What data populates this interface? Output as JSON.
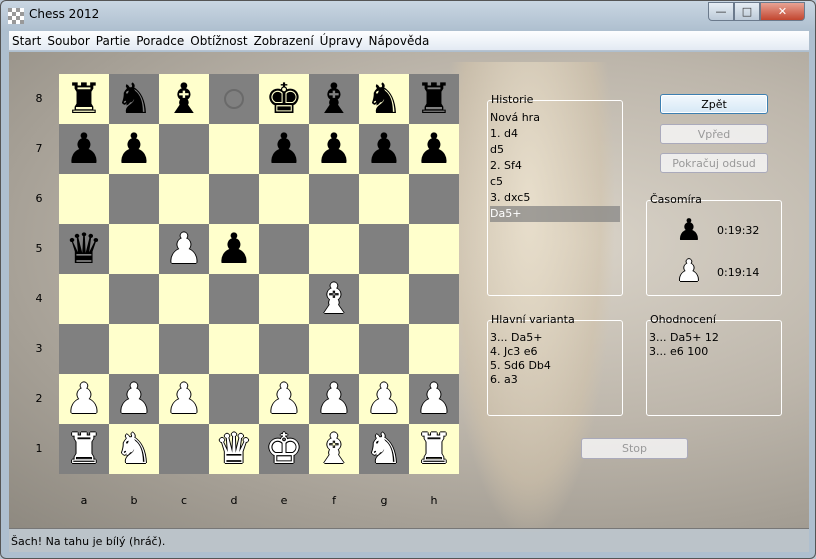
{
  "window": {
    "title": "Chess 2012",
    "controls": {
      "minimize": "—",
      "maximize": "□",
      "close": "✕"
    }
  },
  "menu": [
    "Start",
    "Soubor",
    "Partie",
    "Poradce",
    "Obtížnost",
    "Zobrazení",
    "Úpravy",
    "Nápověda"
  ],
  "board": {
    "ranks": [
      "8",
      "7",
      "6",
      "5",
      "4",
      "3",
      "2",
      "1"
    ],
    "files": [
      "a",
      "b",
      "c",
      "d",
      "e",
      "f",
      "g",
      "h"
    ],
    "position": [
      [
        "r",
        "n",
        "b",
        "*",
        "k",
        "b",
        "n",
        "r"
      ],
      [
        "p",
        "p",
        "",
        "",
        "p",
        "p",
        "p",
        "p"
      ],
      [
        "",
        "",
        "",
        "",
        "",
        "",
        "",
        ""
      ],
      [
        "q",
        "",
        "P",
        "p",
        "",
        "",
        "",
        ""
      ],
      [
        "",
        "",
        "",
        "",
        "",
        "B",
        "",
        ""
      ],
      [
        "",
        "",
        "",
        "",
        "",
        "",
        "",
        ""
      ],
      [
        "P",
        "P",
        "P",
        "",
        "P",
        "P",
        "P",
        "P"
      ],
      [
        "R",
        "N",
        "",
        "Q",
        "K",
        "B",
        "N",
        "R"
      ]
    ],
    "colors": {
      "light": "#ffffcc",
      "dark": "#808080"
    }
  },
  "history": {
    "label": "Historie",
    "moves": [
      "Nová hra",
      "1. d4",
      "d5",
      "2. Sf4",
      "c5",
      "3. dxc5",
      "Da5+"
    ],
    "selected_index": 6
  },
  "buttons": {
    "back": "Zpět",
    "forward": "Vpřed",
    "continue": "Pokračuj odsud",
    "stop": "Stop"
  },
  "clock": {
    "label": "Časomíra",
    "black": "0:19:32",
    "white": "0:19:14"
  },
  "main_line": {
    "label": "Hlavní varianta",
    "lines": [
      "3... Da5+",
      "4. Jc3 e6",
      "5. Sd6 Db4",
      "6. a3"
    ]
  },
  "evaluation": {
    "label": "Ohodnocení",
    "lines": [
      "3... Da5+ 12",
      "3... e6 100"
    ]
  },
  "status": "Šach!  Na tahu je bílý (hráč)."
}
